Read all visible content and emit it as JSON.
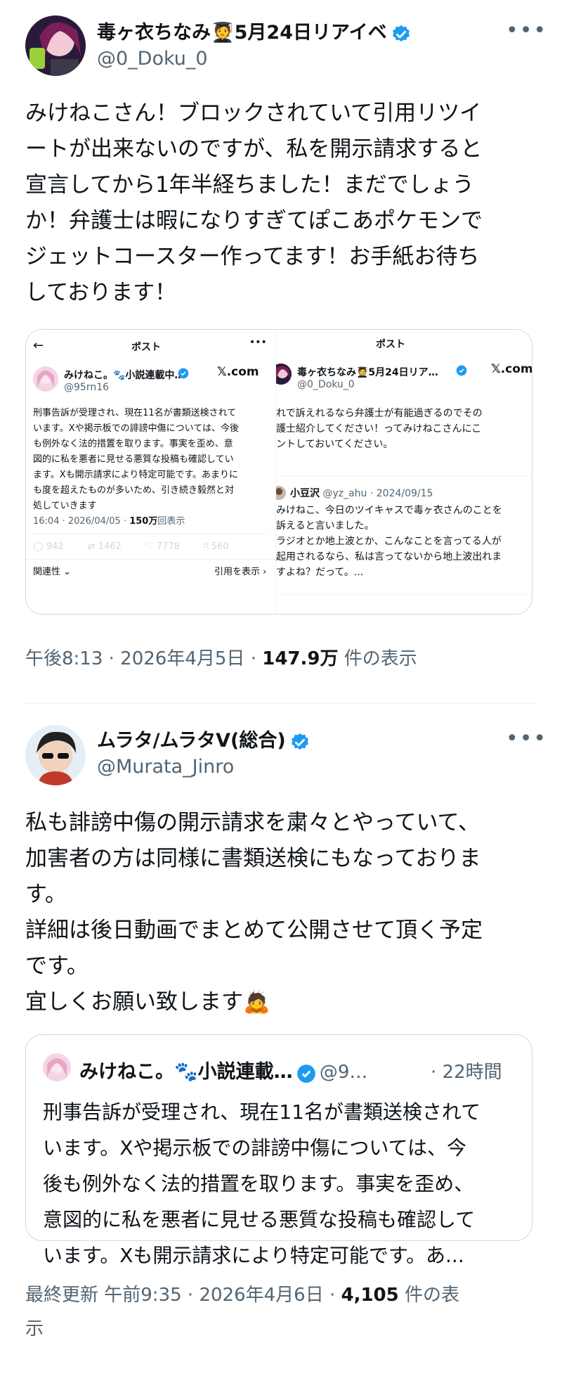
{
  "post1": {
    "name": "毒ヶ衣ちなみ🧑‍🎓5月24日リアイベ",
    "handle": "@0_Doku_0",
    "text": "みけねこさん！ブロックされていて引用リツイ\nートが出来ないのですが、私を開示請求すると\n宣言してから1年半経ちました！まだでしょう\nか！弁護士は暇になりすぎてぽこあポケモンで\nジェットコースター作ってます！お手紙お待ち\nしております！",
    "time": "午後8:13 · 2026年4月5日 · ",
    "views": "147.9万",
    "views_label": " 件の表示"
  },
  "shot_left": {
    "header_title": "ポスト",
    "name": "みけねこ。🐾小説連載中…",
    "handle": "@95rn16",
    "source": "𝕏.com",
    "text": "刑事告訴が受理され、現在11名が書類送検されて\nいます。Xや掲示板での誹謗中傷については、今後\nも例外なく法的措置を取ります。事実を歪め、意\n図的に私を悪者に見せる悪質な投稿も確認してい\nます。Xも開示請求により特定可能です。あまりに\nも度を超えたものが多いため、引き続き毅然と対\n処していきます",
    "time": "16:04 · 2026/04/05 · ",
    "views": "150万",
    "views_label": "回表示",
    "stats": [
      "942",
      "1462",
      "7778",
      "560"
    ],
    "footer_left": "関連性 ⌄",
    "footer_right": "引用を表示 ›"
  },
  "shot_right": {
    "header_title": "ポスト",
    "name": "毒ヶ衣ちなみ🧑‍🎓5月24日リア…",
    "handle": "@0_Doku_0",
    "source": "𝕏.com",
    "text": "れで訴えれるなら弁護士が有能過ぎるのでその\n護士紹介してください！ってみけねこさんにこ\nントしておいてください。",
    "reply_name": "小豆沢",
    "reply_meta": " @yz_ahu · 2024/09/15",
    "reply_text": "みけねこ、今日のツイキャスで毒ヶ衣さんのことを\n訴えると言いました。\nラジオとか地上波とか、こんなことを言ってる人が\n起用されるなら、私は言ってないから地上波出れま\nすよね？だって。..."
  },
  "post2": {
    "name": "ムラタ/ムラタV(総合)",
    "handle": "@Murata_Jinro",
    "text": "私も誹謗中傷の開示請求を粛々とやっていて、\n加害者の方は同様に書類送検にもなっておりま\nす。\n詳細は後日動画でまとめて公開させて頂く予定\nです。\n宜しくお願い致します🙇",
    "quote_name": "みけねこ。🐾小説連載…",
    "quote_handle": "@9…",
    "quote_time": "· 22時間",
    "quote_text": "刑事告訴が受理され、現在11名が書類送検されて\nいます。Xや掲示板での誹謗中傷については、今\n後も例外なく法的措置を取ります。事実を歪め、\n意図的に私を悪者に見せる悪質な投稿も確認して\nいます。Xも開示請求により特定可能です。あ...",
    "updated": "最終更新 午前9:35 · 2026年4月6日 · ",
    "views": "4,105",
    "views_label": " 件の表",
    "views_label_wrap": "示"
  },
  "more_icon": "more-horizontal-icon",
  "colors": {
    "verified": "#1d9bf0",
    "muted": "#536471",
    "border": "#cfd9de"
  }
}
